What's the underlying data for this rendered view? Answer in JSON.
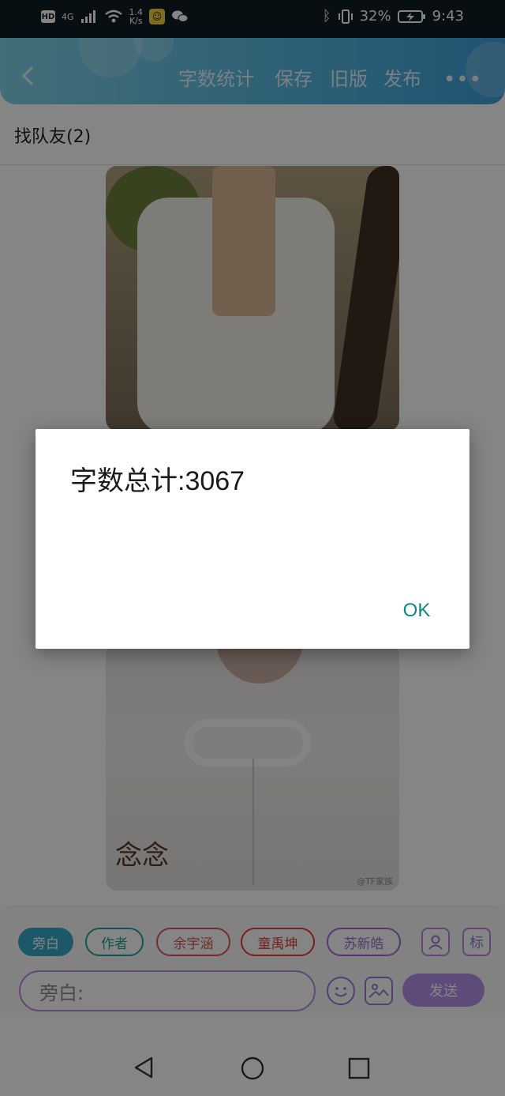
{
  "status_bar": {
    "hd": "HD",
    "network": "4G",
    "speed_value": "1.4",
    "speed_unit": "K/s",
    "battery": "32%",
    "time": "9:43"
  },
  "app_bar": {
    "actions": [
      "字数统计",
      "保存",
      "旧版",
      "发布"
    ],
    "more": "•••"
  },
  "title": "找队友(2)",
  "photo2_watermark": "@TF家族",
  "panel": {
    "chips": [
      {
        "label": "旁白",
        "color": "#38a9c9",
        "active": true
      },
      {
        "label": "作者",
        "color": "#1fa39a",
        "active": false
      },
      {
        "label": "余宇涵",
        "color": "#e0535d",
        "active": false
      },
      {
        "label": "童禹坤",
        "color": "#e0403a",
        "active": false
      },
      {
        "label": "苏新皓",
        "color": "#9a6fd3",
        "active": false
      }
    ],
    "mark_label": "标",
    "input_placeholder": "旁白:",
    "send_label": "发送"
  },
  "dialog": {
    "message": "字数总计:3067",
    "ok_label": "OK"
  },
  "colors": {
    "accent_teal": "#0c8a7e",
    "purple": "#b590e8",
    "appbar_gradient_start": "#7fd3e6",
    "appbar_gradient_end": "#3fa0d8"
  }
}
